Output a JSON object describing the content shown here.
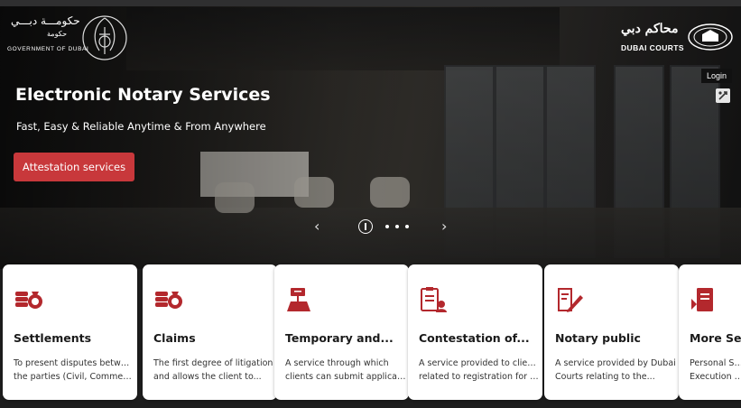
{
  "header": {
    "gov_arabic": "حكومـــة دبـــي",
    "gov_arabic_sub": "حكومة",
    "gov_english": "GOVERNMENT OF DUBAI",
    "courts_arabic": "محاكم دبي",
    "courts_english": "DUBAI COURTS",
    "login_label": "Login"
  },
  "hero": {
    "title": "Electronic Notary Services",
    "subtitle": "Fast, Easy & Reliable Anytime & From Anywhere",
    "cta_label": "Attestation services",
    "prev_icon": "chevron-left-icon",
    "next_icon": "chevron-right-icon",
    "slides_shown": 4,
    "active_slide": 1
  },
  "colors": {
    "accent": "#c8383b",
    "card_bg": "#ffffff"
  },
  "cards": [
    {
      "icon": "settlements-icon",
      "title": "Settlements",
      "desc_line1": "To present disputes between",
      "desc_line2": "the parties (Civil, Commercia..."
    },
    {
      "icon": "claims-icon",
      "title": "Claims",
      "desc_line1": "The first degree of litigation",
      "desc_line2": "and allows the client to..."
    },
    {
      "icon": "temporary-icon",
      "title": "Temporary and...",
      "desc_line1": "A service through which",
      "desc_line2": "clients can submit applicato..."
    },
    {
      "icon": "contestation-icon",
      "title": "Contestation of...",
      "desc_line1": "A service provided to clients",
      "desc_line2": "related to registration for all..."
    },
    {
      "icon": "notary-public-icon",
      "title": "Notary public",
      "desc_line1": "A service provided by Dubai",
      "desc_line2": "Courts relating to the..."
    },
    {
      "icon": "more-services-icon",
      "title": "More Serv",
      "desc_line1": "Personal Statu",
      "desc_line2": "Execution of J"
    }
  ]
}
